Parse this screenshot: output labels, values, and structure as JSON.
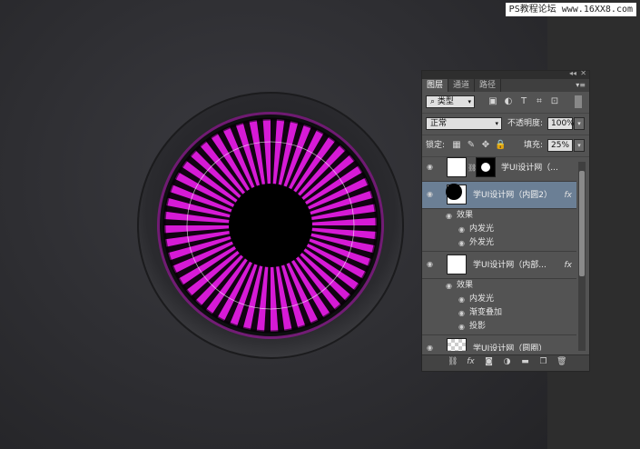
{
  "watermark": "PS教程论坛 www.16XX8.com",
  "panel": {
    "tabs": [
      "图层",
      "通道",
      "路径"
    ],
    "filter_kind": "类型",
    "blend_mode": "正常",
    "opacity_label": "不透明度:",
    "opacity_value": "100%",
    "lock_label": "锁定:",
    "fill_label": "填充:",
    "fill_value": "25%"
  },
  "layers": [
    {
      "name": "学UI设计网（...",
      "fx": "",
      "selected": false
    },
    {
      "name": "学UI设计网（内圆2）",
      "fx": "fx",
      "selected": true,
      "effects_title": "效果",
      "effects": [
        "内发光",
        "外发光"
      ]
    },
    {
      "name": "学UI设计网（内部...",
      "fx": "fx",
      "selected": false,
      "effects_title": "效果",
      "effects": [
        "内发光",
        "渐变叠加",
        "投影"
      ]
    },
    {
      "name": "学UI设计网（圆圈）",
      "fx": "",
      "selected": false
    }
  ],
  "colors": {
    "accent_magenta": "#d61ad6",
    "selected_layer": "#6b7f95"
  },
  "icons": [
    "search-icon",
    "image-filter-icon",
    "adjustment-filter-icon",
    "type-filter-icon",
    "shape-filter-icon",
    "smart-object-filter-icon",
    "lock-pixels-icon",
    "lock-paint-icon",
    "lock-position-icon",
    "lock-all-icon",
    "eye-icon",
    "link-icon",
    "fx-icon",
    "mask-icon",
    "adjustment-layer-icon",
    "folder-icon",
    "new-layer-icon",
    "trash-icon"
  ]
}
